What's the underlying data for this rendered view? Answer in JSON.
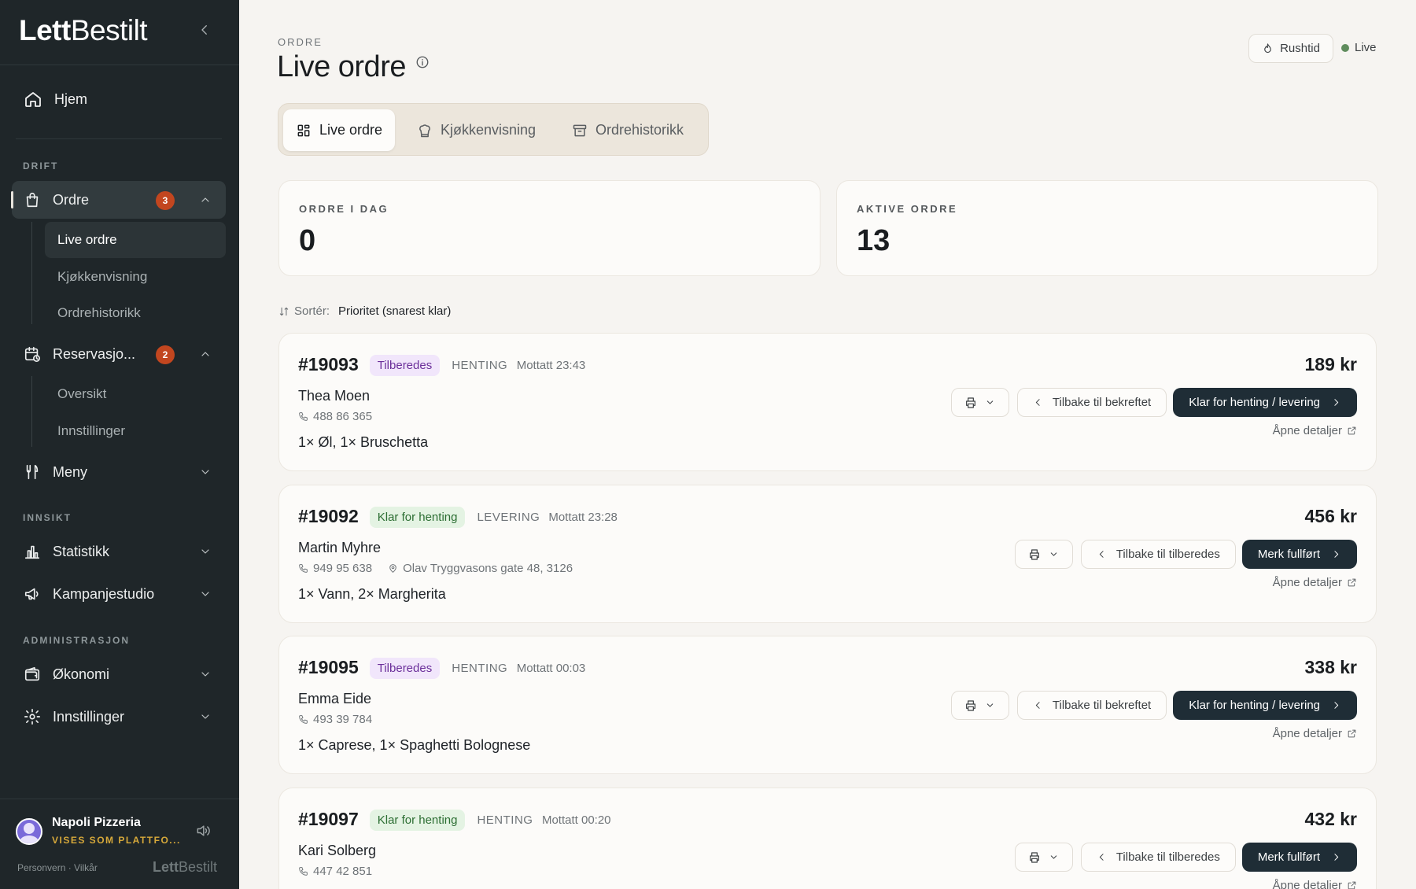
{
  "sidebar": {
    "logo_bold": "Lett",
    "logo_light": "Bestilt",
    "home": "Hjem",
    "sections": {
      "drift": "DRIFT",
      "innsikt": "INNSIKT",
      "admin": "ADMINISTRASJON"
    },
    "ordre": {
      "label": "Ordre",
      "badge": "3",
      "subs": [
        "Live ordre",
        "Kjøkkenvisning",
        "Ordrehistorikk"
      ]
    },
    "reservasjoner": {
      "label": "Reservasjo...",
      "badge": "2",
      "subs": [
        "Oversikt",
        "Innstillinger"
      ]
    },
    "meny": "Meny",
    "statistikk": "Statistikk",
    "kampanjestudio": "Kampanjestudio",
    "okonomi": "Økonomi",
    "innstillinger": "Innstillinger",
    "footer": {
      "org": "Napoli Pizzeria",
      "org_sub": "VISES SOM PLATTFO...",
      "links": "Personvern · Vilkår",
      "logo_bold": "Lett",
      "logo_light": "Bestilt"
    }
  },
  "header": {
    "crumb": "ORDRE",
    "title": "Live ordre",
    "rush": "Rushtid",
    "live": "Live"
  },
  "tabs": [
    "Live ordre",
    "Kjøkkenvisning",
    "Ordrehistorikk"
  ],
  "stats": [
    {
      "label": "ORDRE I DAG",
      "value": "0"
    },
    {
      "label": "AKTIVE ORDRE",
      "value": "13"
    }
  ],
  "sort": {
    "label": "Sortér:",
    "value": "Prioritet (snarest klar)"
  },
  "orders": [
    {
      "id": "#19093",
      "status": "Tilberedes",
      "mode": "HENTING",
      "received": "Mottatt 23:43",
      "customer": "Thea Moen",
      "phone": "488 86 365",
      "address": "",
      "items": "1× Øl, 1× Bruschetta",
      "amount": "189 kr",
      "back": "Tilbake til bekreftet",
      "primary": "Klar for henting / levering",
      "details": "Åpne detaljer"
    },
    {
      "id": "#19092",
      "status": "Klar for henting",
      "mode": "LEVERING",
      "received": "Mottatt 23:28",
      "customer": "Martin Myhre",
      "phone": "949 95 638",
      "address": "Olav Tryggvasons gate 48, 3126",
      "items": "1× Vann, 2× Margherita",
      "amount": "456 kr",
      "back": "Tilbake til tilberedes",
      "primary": "Merk fullført",
      "details": "Åpne detaljer"
    },
    {
      "id": "#19095",
      "status": "Tilberedes",
      "mode": "HENTING",
      "received": "Mottatt 00:03",
      "customer": "Emma Eide",
      "phone": "493 39 784",
      "address": "",
      "items": "1× Caprese, 1× Spaghetti Bolognese",
      "amount": "338 kr",
      "back": "Tilbake til bekreftet",
      "primary": "Klar for henting / levering",
      "details": "Åpne detaljer"
    },
    {
      "id": "#19097",
      "status": "Klar for henting",
      "mode": "HENTING",
      "received": "Mottatt 00:20",
      "customer": "Kari Solberg",
      "phone": "447 42 851",
      "address": "",
      "items": "",
      "amount": "432 kr",
      "back": "Tilbake til tilberedes",
      "primary": "Merk fullført",
      "details": "Åpne detaljer"
    }
  ],
  "colors": {
    "sidebar": "#1f2629",
    "badge": "#c2461f",
    "primary_button": "#1f2d36",
    "status_preparing": "#f1e6fb",
    "status_ready": "#e4f3e3",
    "live_dot": "#5f8c5d"
  }
}
